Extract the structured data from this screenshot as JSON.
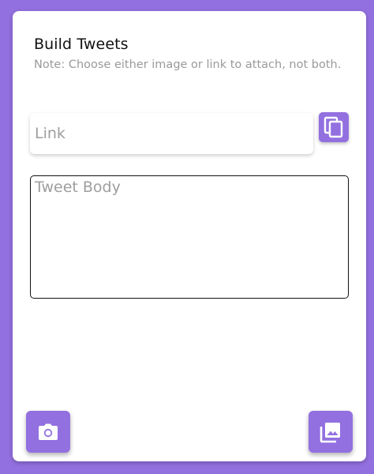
{
  "header": {
    "title": "Build Tweets",
    "note": "Note: Choose either image or link to attach, not both."
  },
  "link_input": {
    "placeholder": "Link",
    "value": ""
  },
  "paste_button": {
    "icon": "copy-icon"
  },
  "body_input": {
    "placeholder": "Tweet Body",
    "value": ""
  },
  "actions": {
    "camera_icon": "camera-icon",
    "gallery_icon": "gallery-icon"
  },
  "colors": {
    "accent": "#9370e0",
    "background": "#9370e0",
    "card": "#ffffff"
  }
}
